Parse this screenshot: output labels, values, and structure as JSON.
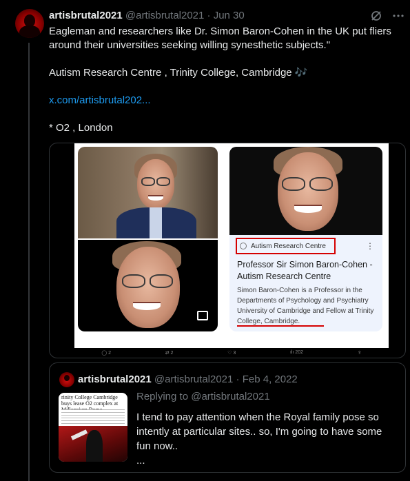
{
  "tweet": {
    "author_name": "artisbrutal2021",
    "author_handle": "@artisbrutal2021",
    "date": "· Jun 30",
    "body_lines": [
      "Eagleman and researchers like Dr. Simon  Baron-Cohen in the UK put fliers",
      "around their universities  seeking willing synesthetic subjects.\"",
      "",
      "Autism Research Centre , Trinity College, Cambridge 🎶",
      "",
      "x.com/artisbrutal202...",
      "",
      "* O2 , London"
    ],
    "link_line_index": 5
  },
  "media": {
    "source_label": "Autism Research Centre",
    "card_title": "Professor Sir Simon Baron-Cohen - Autism Research Centre",
    "card_desc": "Simon Baron-Cohen is a Professor in the Departments of Psychology and Psychiatry University of Cambridge and Fellow at Trinity College, Cambridge.",
    "stats": [
      "◯ 2",
      "⇄ 2",
      "♡ 3",
      "ılı 202",
      "⇪"
    ]
  },
  "quote": {
    "author_name": "artisbrutal2021",
    "author_handle": "@artisbrutal2021",
    "date": "· Feb 4, 2022",
    "replying_to": "Replying to @artisbrutal2021",
    "thumb_headline": "rinity College Cambridge buys lease O2 complex at Millennium Dome",
    "body_lines": [
      "I tend to pay attention when the Royal family pose so",
      "intently at particular sites.. so, I'm going to have some",
      "fun now..",
      "..."
    ]
  },
  "icons": {
    "grok": "grok-icon",
    "more": "more-dots-icon"
  },
  "colors": {
    "link": "#1d9bf0",
    "highlight_red": "#d50000",
    "muted": "#71767b"
  }
}
